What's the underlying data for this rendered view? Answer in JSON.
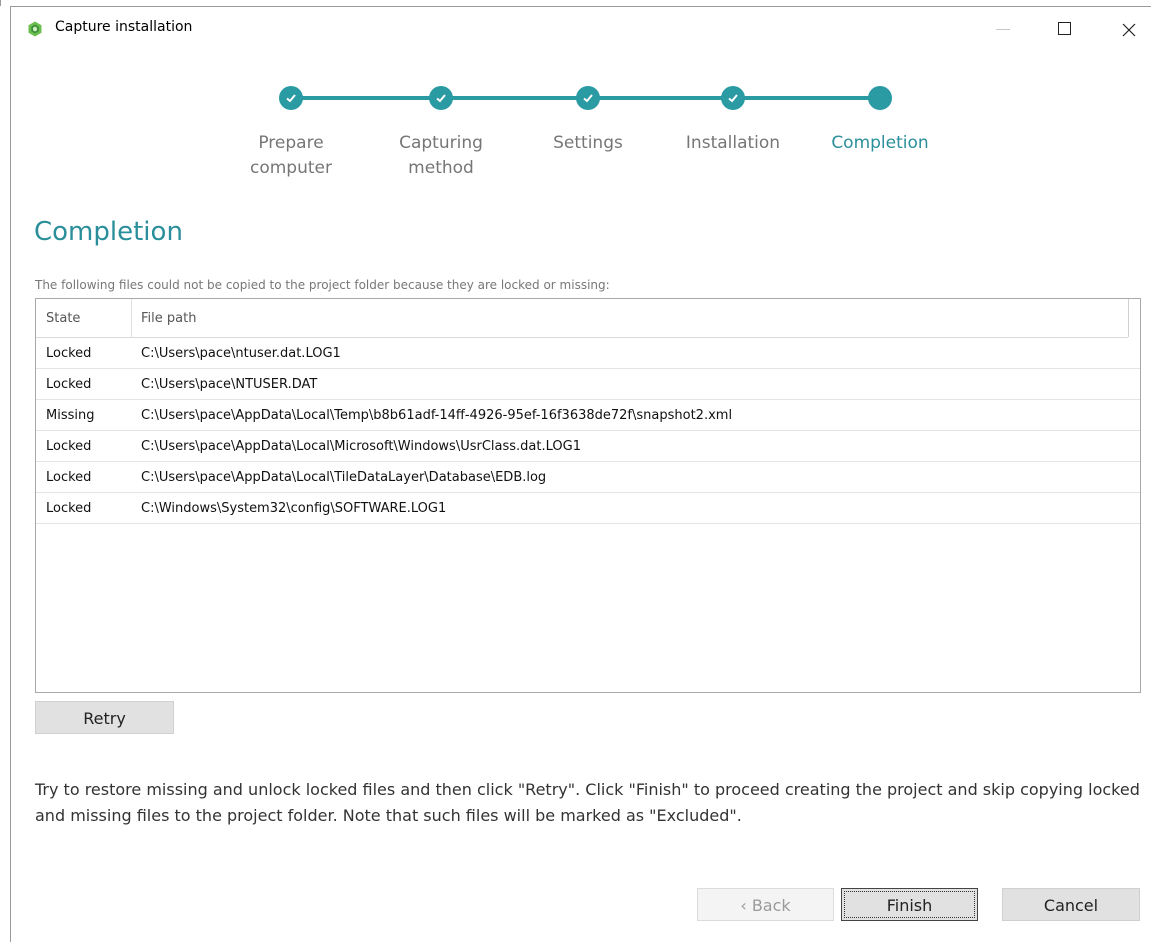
{
  "window": {
    "title": "Capture installation",
    "app_icon": "app-logo-icon",
    "controls": [
      "minimize",
      "maximize",
      "close"
    ]
  },
  "stepper": {
    "steps": [
      {
        "label": "Prepare computer",
        "lines": [
          "Prepare",
          "computer"
        ],
        "state": "done"
      },
      {
        "label": "Capturing method",
        "lines": [
          "Capturing",
          "method"
        ],
        "state": "done"
      },
      {
        "label": "Settings",
        "lines": [
          "Settings"
        ],
        "state": "done"
      },
      {
        "label": "Installation",
        "lines": [
          "Installation"
        ],
        "state": "done"
      },
      {
        "label": "Completion",
        "lines": [
          "Completion"
        ],
        "state": "active"
      }
    ]
  },
  "page": {
    "heading": "Completion",
    "intro": "The following files could not be copied to the project folder because they are locked or missing:"
  },
  "table": {
    "headers": {
      "state": "State",
      "path": "File path"
    },
    "rows": [
      {
        "state": "Locked",
        "path": "C:\\Users\\pace\\ntuser.dat.LOG1"
      },
      {
        "state": "Locked",
        "path": "C:\\Users\\pace\\NTUSER.DAT"
      },
      {
        "state": "Missing",
        "path": "C:\\Users\\pace\\AppData\\Local\\Temp\\b8b61adf-14ff-4926-95ef-16f3638de72f\\snapshot2.xml"
      },
      {
        "state": "Locked",
        "path": "C:\\Users\\pace\\AppData\\Local\\Microsoft\\Windows\\UsrClass.dat.LOG1"
      },
      {
        "state": "Locked",
        "path": "C:\\Users\\pace\\AppData\\Local\\TileDataLayer\\Database\\EDB.log"
      },
      {
        "state": "Locked",
        "path": "C:\\Windows\\System32\\config\\SOFTWARE.LOG1"
      }
    ]
  },
  "buttons": {
    "retry": "Retry",
    "back": "‹ Back",
    "finish": "Finish",
    "cancel": "Cancel"
  },
  "note": "Try to restore missing and unlock locked files and then click \"Retry\". Click \"Finish\" to proceed creating the project and skip copying locked and missing files to the project folder. Note that such files will be marked as \"Excluded\".",
  "colors": {
    "accent": "#2a9aa3",
    "heading": "#2a8f9a"
  }
}
